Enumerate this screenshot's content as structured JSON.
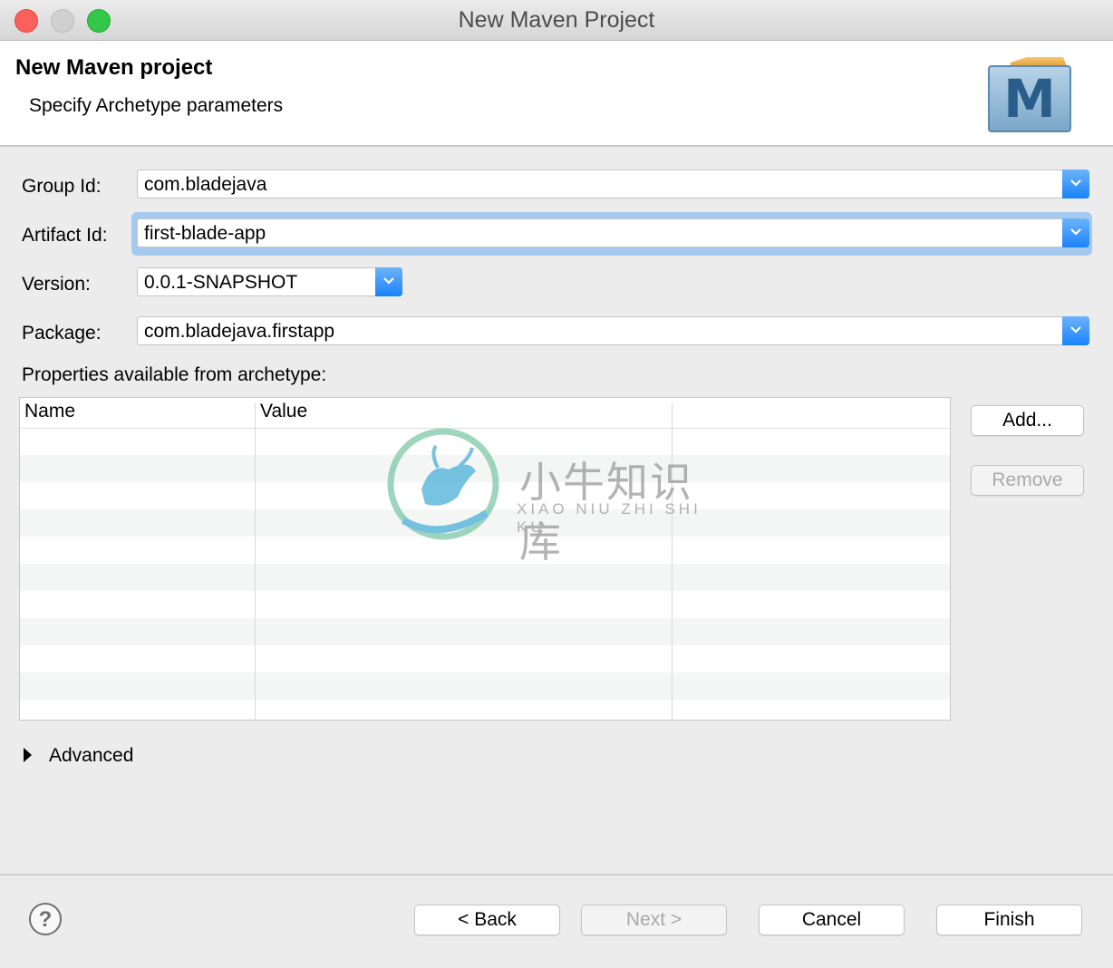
{
  "window": {
    "title": "New Maven Project"
  },
  "header": {
    "title": "New Maven project",
    "subtitle": "Specify Archetype parameters",
    "logo_letter": "M"
  },
  "form": {
    "group_id": {
      "label": "Group Id:",
      "value": "com.bladejava"
    },
    "artifact_id": {
      "label": "Artifact Id:",
      "value": "first-blade-app"
    },
    "version": {
      "label": "Version:",
      "value": "0.0.1-SNAPSHOT"
    },
    "package": {
      "label": "Package:",
      "value": "com.bladejava.firstapp"
    }
  },
  "properties": {
    "label": "Properties available from archetype:",
    "columns": [
      "Name",
      "Value"
    ],
    "add_label": "Add...",
    "remove_label": "Remove"
  },
  "advanced": {
    "label": "Advanced"
  },
  "footer": {
    "help": "?",
    "back_label": "< Back",
    "next_label": "Next >",
    "cancel_label": "Cancel",
    "finish_label": "Finish"
  },
  "watermark": {
    "chinese": "小牛知识库",
    "pinyin": "XIAO NIU ZHI SHI KU"
  },
  "colors": {
    "accent": "#1a82fb",
    "focus_ring": "#a5c9ef",
    "close": "#fc605c",
    "maximize": "#34c84a"
  }
}
